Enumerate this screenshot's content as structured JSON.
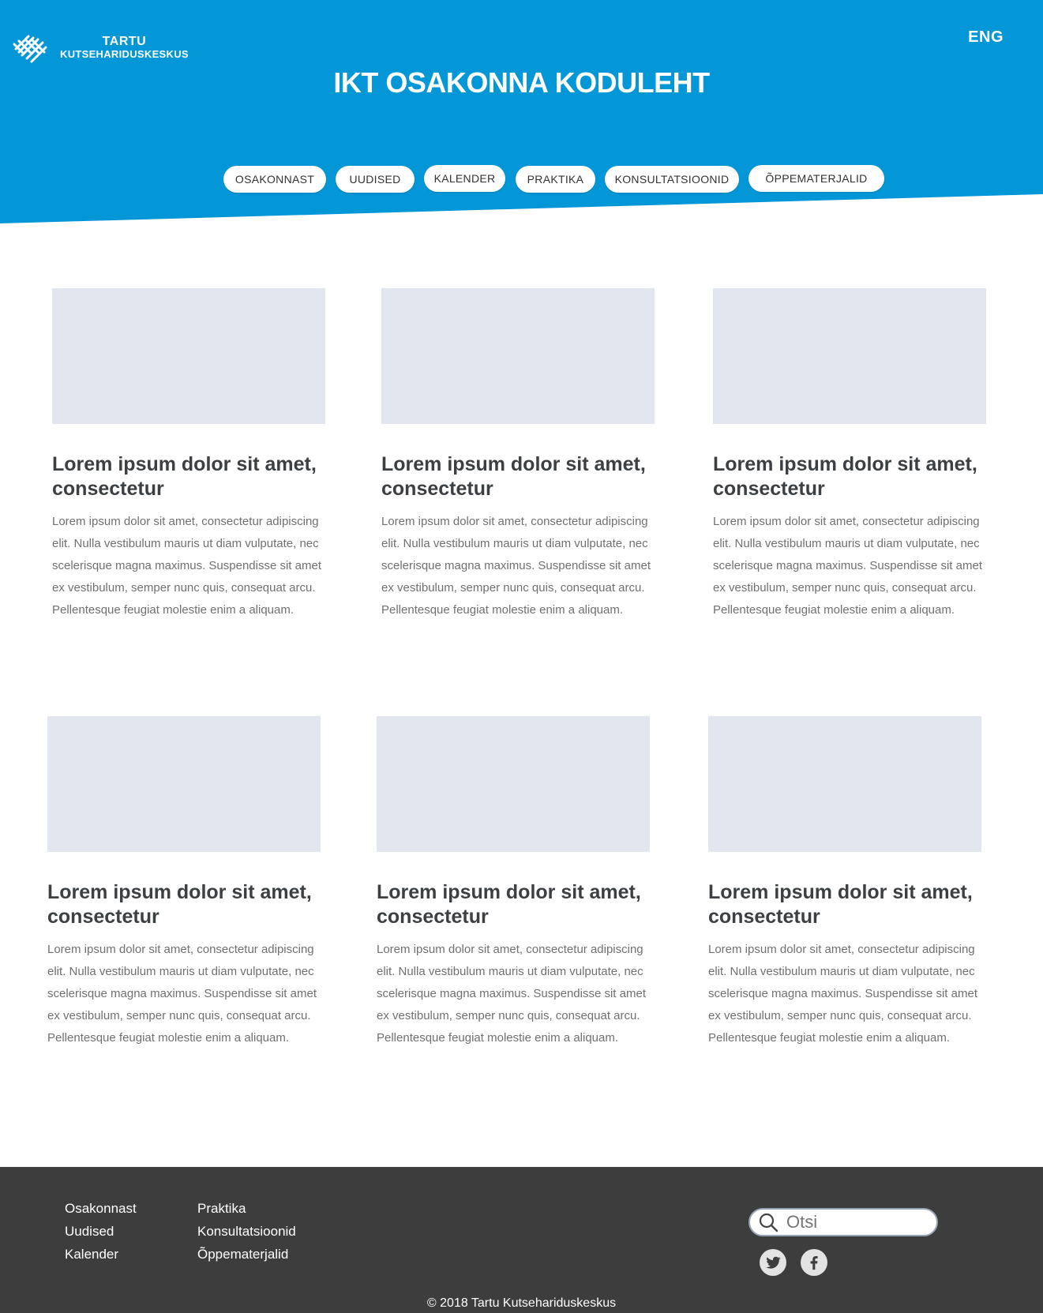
{
  "header": {
    "logo_line1": "TARTU",
    "logo_line2": "KUTSEHARIDUSKESKUS",
    "language": "ENG",
    "title": "IKT OSAKONNA KODULEHT",
    "accent_color": "#0497d8"
  },
  "nav": {
    "items": [
      {
        "label": "OSAKONNAST"
      },
      {
        "label": "UUDISED"
      },
      {
        "label": "KALENDER"
      },
      {
        "label": "PRAKTIKA"
      },
      {
        "label": "KONSULTATSIOONID"
      },
      {
        "label": "ÕPPEMATERJALID"
      }
    ]
  },
  "cards": [
    {
      "title": "Lorem ipsum dolor sit amet, consectetur",
      "text": "Lorem ipsum dolor sit amet, consectetur adipiscing elit. Nulla vestibulum mauris ut diam vulputate, nec scelerisque magna maximus. Suspendisse sit amet ex vestibulum, semper nunc quis, consequat arcu. Pellentesque feugiat molestie enim a aliquam."
    },
    {
      "title": "Lorem ipsum dolor sit amet, consectetur",
      "text": "Lorem ipsum dolor sit amet, consectetur adipiscing elit. Nulla vestibulum mauris ut diam vulputate, nec scelerisque magna maximus. Suspendisse sit amet ex vestibulum, semper nunc quis, consequat arcu. Pellentesque feugiat molestie enim a aliquam."
    },
    {
      "title": "Lorem ipsum dolor sit amet, consectetur",
      "text": "Lorem ipsum dolor sit amet, consectetur adipiscing elit. Nulla vestibulum mauris ut diam vulputate, nec scelerisque magna maximus. Suspendisse sit amet ex vestibulum, semper nunc quis, consequat arcu. Pellentesque feugiat molestie enim a aliquam."
    },
    {
      "title": "Lorem ipsum dolor sit amet, consectetur",
      "text": "Lorem ipsum dolor sit amet, consectetur adipiscing elit. Nulla vestibulum mauris ut diam vulputate, nec scelerisque magna maximus. Suspendisse sit amet ex vestibulum, semper nunc quis, consequat arcu. Pellentesque feugiat molestie enim a aliquam."
    },
    {
      "title": "Lorem ipsum dolor sit amet, consectetur",
      "text": "Lorem ipsum dolor sit amet, consectetur adipiscing elit. Nulla vestibulum mauris ut diam vulputate, nec scelerisque magna maximus. Suspendisse sit amet ex vestibulum, semper nunc quis, consequat arcu. Pellentesque feugiat molestie enim a aliquam."
    },
    {
      "title": "Lorem ipsum dolor sit amet, consectetur",
      "text": "Lorem ipsum dolor sit amet, consectetur adipiscing elit. Nulla vestibulum mauris ut diam vulputate, nec scelerisque magna maximus. Suspendisse sit amet ex vestibulum, semper nunc quis, consequat arcu. Pellentesque feugiat molestie enim a aliquam."
    }
  ],
  "footer": {
    "col1": [
      {
        "label": "Osakonnast"
      },
      {
        "label": "Uudised"
      },
      {
        "label": "Kalender"
      }
    ],
    "col2": [
      {
        "label": "Praktika"
      },
      {
        "label": "Konsultatsioonid"
      },
      {
        "label": "Õppematerjalid"
      }
    ],
    "search_placeholder": "Otsi",
    "social": [
      {
        "icon": "twitter-icon"
      },
      {
        "icon": "facebook-icon"
      }
    ],
    "copyright": "© 2018 Tartu Kutsehariduskeskus"
  }
}
